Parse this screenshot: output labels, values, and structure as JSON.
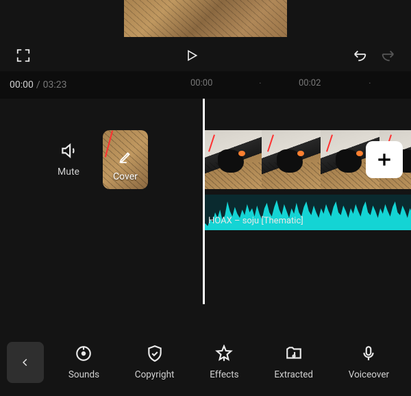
{
  "time": {
    "current": "00:00",
    "total": "03:23"
  },
  "ruler": {
    "ticks": [
      "00:00",
      "00:02"
    ]
  },
  "tools": {
    "mute": "Mute",
    "cover": "Cover"
  },
  "audio": {
    "label": "HOAX – soju [Thematic]"
  },
  "bottom": {
    "items": [
      {
        "label": "Sounds"
      },
      {
        "label": "Copyright"
      },
      {
        "label": "Effects"
      },
      {
        "label": "Extracted"
      },
      {
        "label": "Voiceover"
      }
    ]
  }
}
